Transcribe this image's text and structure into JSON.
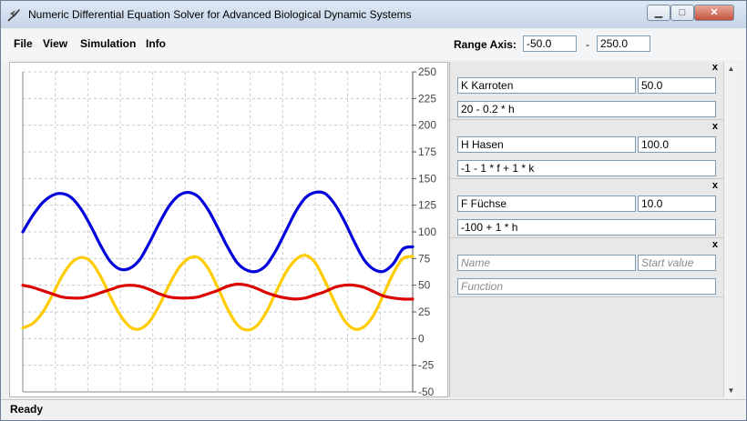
{
  "window": {
    "title": "Numeric Differential Equation Solver for Advanced Biological Dynamic Systems"
  },
  "menu": {
    "items": [
      "File",
      "View",
      "Simulation",
      "Info"
    ]
  },
  "range": {
    "label": "Range Axis:",
    "min": "-50.0",
    "dash": "-",
    "max": "250.0"
  },
  "equations": [
    {
      "name": "K Karroten",
      "start": "50.0",
      "function": "20 - 0.2 * h"
    },
    {
      "name": "H Hasen",
      "start": "100.0",
      "function": "-1 - 1 * f + 1 * k"
    },
    {
      "name": "F Füchse",
      "start": "10.0",
      "function": "-100 + 1 * h"
    }
  ],
  "new_equation": {
    "name_placeholder": "Name",
    "start_placeholder": "Start value",
    "function_placeholder": "Function"
  },
  "close_label": "x",
  "status": "Ready",
  "chart_data": {
    "type": "line",
    "ylim": [
      -50,
      250
    ],
    "yticks": [
      "250",
      "225",
      "200",
      "175",
      "150",
      "125",
      "100",
      "75",
      "50",
      "25",
      "0",
      "-25",
      "-50"
    ],
    "x": [
      0,
      0.5,
      1,
      1.5,
      2,
      2.5,
      3,
      3.5,
      4,
      4.5,
      5,
      5.5,
      6,
      6.5,
      7,
      7.5,
      8,
      8.5,
      9,
      9.5,
      10,
      10.5,
      11,
      11.5,
      12,
      12.5,
      13,
      13.5,
      14,
      14.5,
      15,
      15.5,
      16,
      16.5,
      17,
      17.5,
      18,
      18.5,
      19,
      19.5,
      20
    ],
    "series": [
      {
        "color": "#0000dd",
        "values": [
          100,
          115,
          127,
          134,
          136,
          132,
          121,
          105,
          87,
          72,
          65,
          66,
          74,
          90,
          108,
          124,
          134,
          137,
          133,
          121,
          104,
          86,
          71,
          64,
          63,
          69,
          83,
          101,
          119,
          132,
          137,
          136,
          126,
          110,
          91,
          74,
          65,
          63,
          70,
          84,
          86
        ]
      },
      {
        "color": "#ffcc00",
        "values": [
          10,
          14,
          24,
          40,
          58,
          71,
          76,
          72,
          58,
          39,
          22,
          11,
          9,
          16,
          31,
          50,
          66,
          75,
          76,
          66,
          48,
          28,
          13,
          8,
          12,
          25,
          44,
          62,
          74,
          78,
          71,
          54,
          34,
          17,
          9,
          11,
          22,
          41,
          61,
          75,
          77
        ]
      },
      {
        "color": "#dd0000",
        "values": [
          50,
          48,
          45,
          42,
          39,
          38,
          38,
          40,
          43,
          46,
          49,
          50,
          49,
          46,
          42,
          39,
          38,
          38,
          39,
          42,
          45,
          49,
          51,
          50,
          47,
          43,
          40,
          38,
          37,
          38,
          41,
          44,
          48,
          50,
          50,
          48,
          44,
          40,
          38,
          37,
          37
        ]
      }
    ]
  }
}
